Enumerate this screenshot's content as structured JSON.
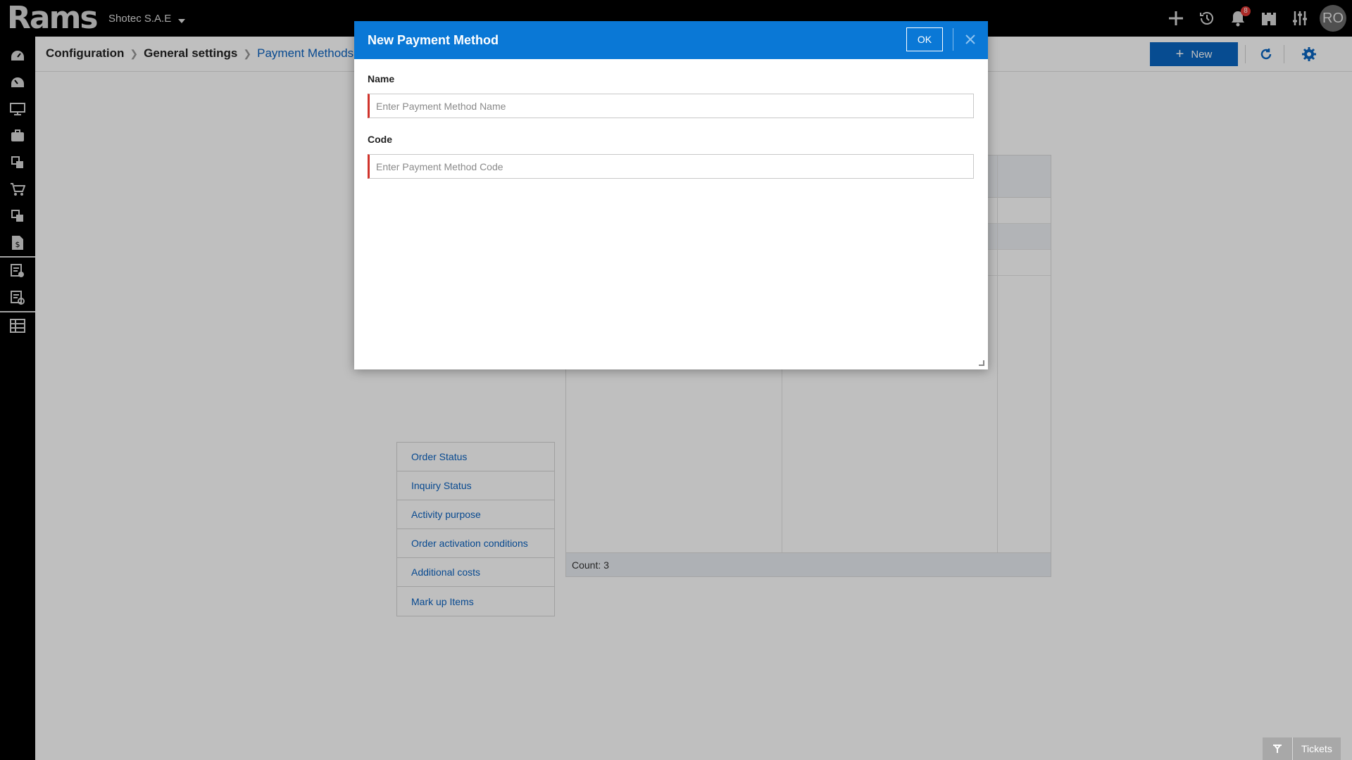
{
  "app": {
    "logo": "Rams",
    "company": "Shotec S.A.E",
    "notification_count": "8",
    "avatar_initials": "RO"
  },
  "breadcrumb": {
    "items": [
      "Configuration",
      "General settings",
      "Payment Methods"
    ]
  },
  "toolbar": {
    "new_label": "New"
  },
  "settings_menu": {
    "items": [
      "Order Status",
      "Inquiry Status",
      "Activity purpose",
      "Order activation conditions",
      "Additional costs",
      "Mark up Items"
    ]
  },
  "grid": {
    "count_text": "Count: 3"
  },
  "modal": {
    "title": "New Payment Method",
    "ok_label": "OK",
    "name_label": "Name",
    "name_placeholder": "Enter Payment Method Name",
    "name_value": "",
    "code_label": "Code",
    "code_placeholder": "Enter Payment Method Code",
    "code_value": ""
  },
  "footer": {
    "tickets_label": "Tickets"
  },
  "colors": {
    "accent": "#0a78d6",
    "primary_button": "#0a66c2",
    "required_marker": "#d0342c",
    "badge": "#e53935"
  },
  "icons": {
    "sidebar": [
      "dashboard-icon",
      "speedometer-icon",
      "monitor-icon",
      "briefcase-icon",
      "documents-icon",
      "cart-icon",
      "documents-2-icon",
      "invoice-dollar-icon",
      "report-check-icon",
      "report-gear-icon",
      "grid-layout-icon"
    ],
    "topbar": [
      "plus-icon",
      "history-icon",
      "bell-icon",
      "castle-icon",
      "sliders-icon"
    ]
  }
}
